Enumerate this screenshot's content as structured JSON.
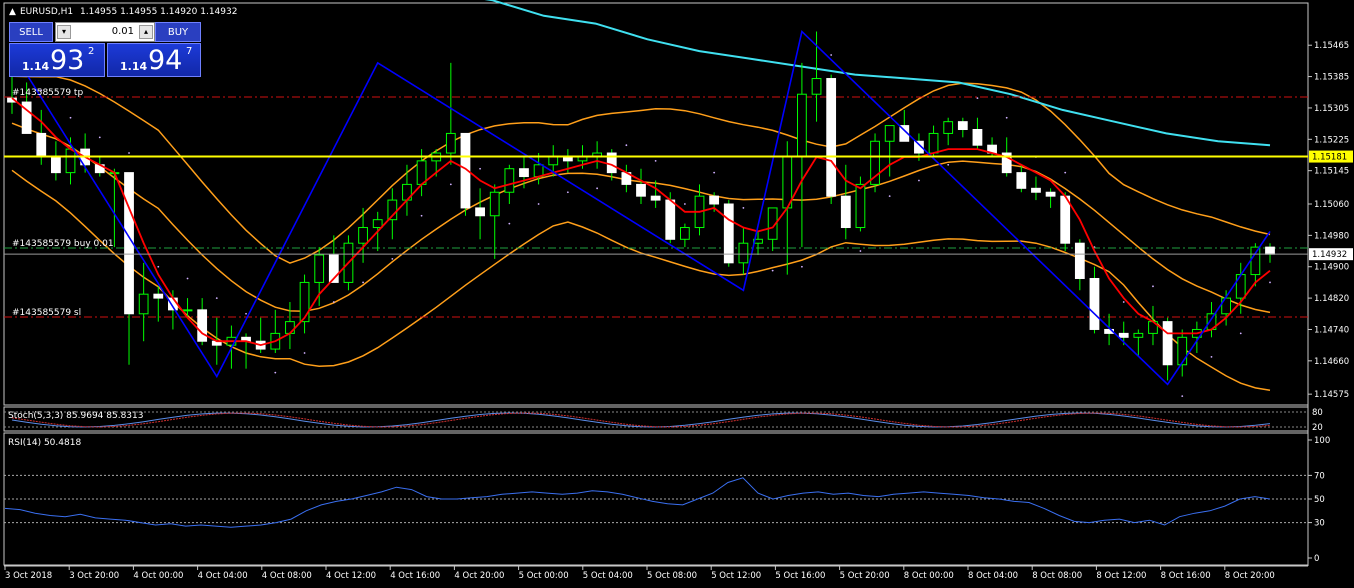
{
  "header": {
    "symbol": "EURUSD,H1",
    "ohlc": "1.14955 1.14955 1.14920 1.14932"
  },
  "trade_panel": {
    "sell_label": "SELL",
    "buy_label": "BUY",
    "lot_value": "0.01",
    "sell_price_small": "1.14",
    "sell_price_big": "93",
    "sell_price_sup": "2",
    "buy_price_small": "1.14",
    "buy_price_big": "94",
    "buy_price_sup": "7"
  },
  "order_lines": {
    "tp_label": "#143585579 tp",
    "buy_label": "#143585579 buy 0.01",
    "sl_label": "#143585579 sl"
  },
  "price_axis": {
    "ticks": [
      "1.15465",
      "1.15385",
      "1.15305",
      "1.15225",
      "1.15145",
      "1.15060",
      "1.14980",
      "1.14900",
      "1.14820",
      "1.14740",
      "1.14660",
      "1.14575"
    ],
    "hline_label": "1.15181",
    "bid_label": "1.14932"
  },
  "time_axis": {
    "labels": [
      "3 Oct 2018",
      "3 Oct 20:00",
      "4 Oct 00:00",
      "4 Oct 04:00",
      "4 Oct 08:00",
      "4 Oct 12:00",
      "4 Oct 16:00",
      "4 Oct 20:00",
      "5 Oct 00:00",
      "5 Oct 04:00",
      "5 Oct 08:00",
      "5 Oct 12:00",
      "5 Oct 16:00",
      "5 Oct 20:00",
      "8 Oct 00:00",
      "8 Oct 04:00",
      "8 Oct 08:00",
      "8 Oct 12:00",
      "8 Oct 16:00",
      "8 Oct 20:00"
    ]
  },
  "stoch": {
    "label": "Stoch(5,3,3) 85.9694 85.8313",
    "levels": [
      "80",
      "20"
    ]
  },
  "rsi": {
    "label": "RSI(14) 50.4818",
    "ticks": [
      "100",
      "70",
      "50",
      "30",
      "0"
    ]
  },
  "colors": {
    "bull_candle": "#ffffff",
    "bear_candle": "#ffffff",
    "wick": "#00ff00",
    "ma_red": "#ff0000",
    "bands": "#ff9f1a",
    "ma_slow": "#40e0f0",
    "zigzag": "#0000ff",
    "sar": "#d0b0ff",
    "hline": "#ffff00",
    "tp_sl": "#d01010",
    "buy_line": "#20a040",
    "rsi_line": "#3a6ff0"
  },
  "chart_data": {
    "type": "candlestick",
    "title": "EURUSD,H1",
    "ylim": [
      1.14555,
      1.15565
    ],
    "candles": [
      [
        1.1533,
        1.1546,
        1.1529,
        1.1532
      ],
      [
        1.1532,
        1.1537,
        1.1524,
        1.1524
      ],
      [
        1.1524,
        1.153,
        1.1516,
        1.1518
      ],
      [
        1.1518,
        1.1522,
        1.1512,
        1.1514
      ],
      [
        1.1514,
        1.1523,
        1.1511,
        1.152
      ],
      [
        1.152,
        1.1524,
        1.1514,
        1.1516
      ],
      [
        1.1516,
        1.1518,
        1.1513,
        1.1514
      ],
      [
        1.1514,
        1.1515,
        1.1495,
        1.1514
      ],
      [
        1.1514,
        1.1514,
        1.1465,
        1.1478
      ],
      [
        1.1478,
        1.1491,
        1.1471,
        1.1483
      ],
      [
        1.1483,
        1.1485,
        1.1476,
        1.1482
      ],
      [
        1.1482,
        1.1484,
        1.1474,
        1.1479
      ],
      [
        1.1479,
        1.1482,
        1.1477,
        1.1479
      ],
      [
        1.1479,
        1.1482,
        1.147,
        1.1471
      ],
      [
        1.1471,
        1.1477,
        1.1465,
        1.147
      ],
      [
        1.147,
        1.1475,
        1.1464,
        1.1472
      ],
      [
        1.1472,
        1.1473,
        1.1464,
        1.1471
      ],
      [
        1.1471,
        1.1477,
        1.1468,
        1.1469
      ],
      [
        1.1469,
        1.1479,
        1.1468,
        1.1473
      ],
      [
        1.1473,
        1.1481,
        1.1469,
        1.1476
      ],
      [
        1.1476,
        1.1488,
        1.1473,
        1.1486
      ],
      [
        1.1486,
        1.1495,
        1.148,
        1.1493
      ],
      [
        1.1493,
        1.1498,
        1.1486,
        1.1486
      ],
      [
        1.1486,
        1.1498,
        1.1484,
        1.1496
      ],
      [
        1.1496,
        1.1505,
        1.1491,
        1.15
      ],
      [
        1.15,
        1.1504,
        1.1494,
        1.1502
      ],
      [
        1.1502,
        1.151,
        1.1497,
        1.1507
      ],
      [
        1.1507,
        1.1516,
        1.1503,
        1.1511
      ],
      [
        1.1511,
        1.152,
        1.1508,
        1.1517
      ],
      [
        1.1517,
        1.152,
        1.1513,
        1.1519
      ],
      [
        1.1519,
        1.1542,
        1.1516,
        1.1524
      ],
      [
        1.1524,
        1.1524,
        1.1503,
        1.1505
      ],
      [
        1.1505,
        1.151,
        1.1497,
        1.1503
      ],
      [
        1.1503,
        1.1511,
        1.1492,
        1.1509
      ],
      [
        1.1509,
        1.1516,
        1.1506,
        1.1515
      ],
      [
        1.1515,
        1.1518,
        1.151,
        1.1513
      ],
      [
        1.1513,
        1.1519,
        1.1511,
        1.1516
      ],
      [
        1.1516,
        1.1521,
        1.1513,
        1.1518
      ],
      [
        1.1518,
        1.152,
        1.1514,
        1.1517
      ],
      [
        1.1517,
        1.1521,
        1.1515,
        1.1518
      ],
      [
        1.1518,
        1.1522,
        1.1515,
        1.1519
      ],
      [
        1.1519,
        1.152,
        1.1512,
        1.1514
      ],
      [
        1.1514,
        1.1516,
        1.1509,
        1.1511
      ],
      [
        1.1511,
        1.1515,
        1.1506,
        1.1508
      ],
      [
        1.1508,
        1.1512,
        1.1505,
        1.1507
      ],
      [
        1.1507,
        1.1509,
        1.1496,
        1.1497
      ],
      [
        1.1497,
        1.1501,
        1.1495,
        1.15
      ],
      [
        1.15,
        1.1511,
        1.1498,
        1.1508
      ],
      [
        1.1508,
        1.1509,
        1.1504,
        1.1506
      ],
      [
        1.1506,
        1.1507,
        1.149,
        1.1491
      ],
      [
        1.1491,
        1.15,
        1.1488,
        1.1496
      ],
      [
        1.1496,
        1.1499,
        1.1493,
        1.1497
      ],
      [
        1.1497,
        1.1502,
        1.1494,
        1.1505
      ],
      [
        1.1505,
        1.1522,
        1.1488,
        1.1518
      ],
      [
        1.1518,
        1.1542,
        1.1495,
        1.1534
      ],
      [
        1.1534,
        1.155,
        1.1527,
        1.1538
      ],
      [
        1.1538,
        1.1539,
        1.1506,
        1.1508
      ],
      [
        1.1508,
        1.1516,
        1.1497,
        1.15
      ],
      [
        1.15,
        1.1513,
        1.1499,
        1.1511
      ],
      [
        1.1511,
        1.1524,
        1.1509,
        1.1522
      ],
      [
        1.1522,
        1.1526,
        1.1513,
        1.1526
      ],
      [
        1.1526,
        1.153,
        1.1522,
        1.1522
      ],
      [
        1.1522,
        1.1524,
        1.1517,
        1.1519
      ],
      [
        1.1519,
        1.1526,
        1.1518,
        1.1524
      ],
      [
        1.1524,
        1.1528,
        1.1521,
        1.1527
      ],
      [
        1.1527,
        1.1528,
        1.1523,
        1.1525
      ],
      [
        1.1525,
        1.1528,
        1.152,
        1.1521
      ],
      [
        1.1521,
        1.1523,
        1.1518,
        1.1519
      ],
      [
        1.1519,
        1.1523,
        1.1513,
        1.1514
      ],
      [
        1.1514,
        1.1516,
        1.1509,
        1.151
      ],
      [
        1.151,
        1.1513,
        1.1507,
        1.1509
      ],
      [
        1.1509,
        1.151,
        1.1505,
        1.1508
      ],
      [
        1.1508,
        1.1509,
        1.1494,
        1.1496
      ],
      [
        1.1496,
        1.1497,
        1.1484,
        1.1487
      ],
      [
        1.1487,
        1.149,
        1.1473,
        1.1474
      ],
      [
        1.1474,
        1.1478,
        1.147,
        1.1473
      ],
      [
        1.1473,
        1.1476,
        1.147,
        1.1472
      ],
      [
        1.1472,
        1.1474,
        1.1467,
        1.1473
      ],
      [
        1.1473,
        1.148,
        1.147,
        1.1476
      ],
      [
        1.1476,
        1.1477,
        1.1461,
        1.1465
      ],
      [
        1.1465,
        1.1474,
        1.1462,
        1.1472
      ],
      [
        1.1472,
        1.1476,
        1.1468,
        1.1474
      ],
      [
        1.1474,
        1.1481,
        1.1472,
        1.1478
      ],
      [
        1.1478,
        1.1484,
        1.1475,
        1.1482
      ],
      [
        1.1482,
        1.1491,
        1.1478,
        1.1488
      ],
      [
        1.1488,
        1.1496,
        1.1485,
        1.1495
      ],
      [
        1.1495,
        1.1496,
        1.1491,
        1.14932
      ]
    ],
    "ma_red": [
      1.1533,
      1.153,
      1.1527,
      1.1523,
      1.152,
      1.1518,
      1.1516,
      1.1514,
      1.1505,
      1.1496,
      1.1488,
      1.1482,
      1.1477,
      1.1473,
      1.1471,
      1.1471,
      1.1471,
      1.147,
      1.1471,
      1.1473,
      1.1477,
      1.1483,
      1.1487,
      1.1491,
      1.1495,
      1.1499,
      1.1503,
      1.1507,
      1.1511,
      1.1514,
      1.1517,
      1.1515,
      1.1512,
      1.151,
      1.1511,
      1.1512,
      1.1513,
      1.1514,
      1.1515,
      1.1516,
      1.1517,
      1.1516,
      1.1514,
      1.1512,
      1.151,
      1.1507,
      1.1504,
      1.1504,
      1.1505,
      1.1502,
      1.15,
      1.1499,
      1.15,
      1.1505,
      1.1512,
      1.1518,
      1.1517,
      1.1512,
      1.151,
      1.1513,
      1.1516,
      1.1518,
      1.1518,
      1.1519,
      1.152,
      1.152,
      1.152,
      1.1519,
      1.1518,
      1.1516,
      1.1514,
      1.1512,
      1.1508,
      1.1502,
      1.1494,
      1.1487,
      1.1482,
      1.1478,
      1.1476,
      1.1473,
      1.1473,
      1.1473,
      1.1474,
      1.1477,
      1.1481,
      1.1486,
      1.1489
    ],
    "ma_slow_start": [
      1.156,
      1.1558,
      1.1554,
      1.1552,
      1.1548,
      1.1545,
      1.1543,
      1.1541,
      1.1539,
      1.1538,
      1.1537,
      1.1534,
      1.153,
      1.1527,
      1.1524,
      1.1522,
      1.1521
    ],
    "rsi_values": [
      42,
      41,
      38,
      36,
      35,
      37,
      34,
      33,
      32,
      30,
      28,
      29,
      27,
      28,
      27,
      26,
      27,
      28,
      30,
      33,
      40,
      45,
      48,
      50,
      53,
      56,
      60,
      58,
      52,
      50,
      50,
      51,
      52,
      54,
      55,
      56,
      55,
      54,
      55,
      57,
      56,
      54,
      51,
      48,
      46,
      45,
      50,
      55,
      64,
      68,
      55,
      50,
      53,
      55,
      56,
      54,
      55,
      53,
      52,
      54,
      55,
      56,
      55,
      54,
      53,
      51,
      50,
      48,
      47,
      42,
      36,
      31,
      30,
      32,
      33,
      30,
      32,
      28,
      35,
      38,
      40,
      44,
      50,
      52,
      50
    ],
    "stoch_main": "85.9694",
    "stoch_signal": "85.8313"
  }
}
